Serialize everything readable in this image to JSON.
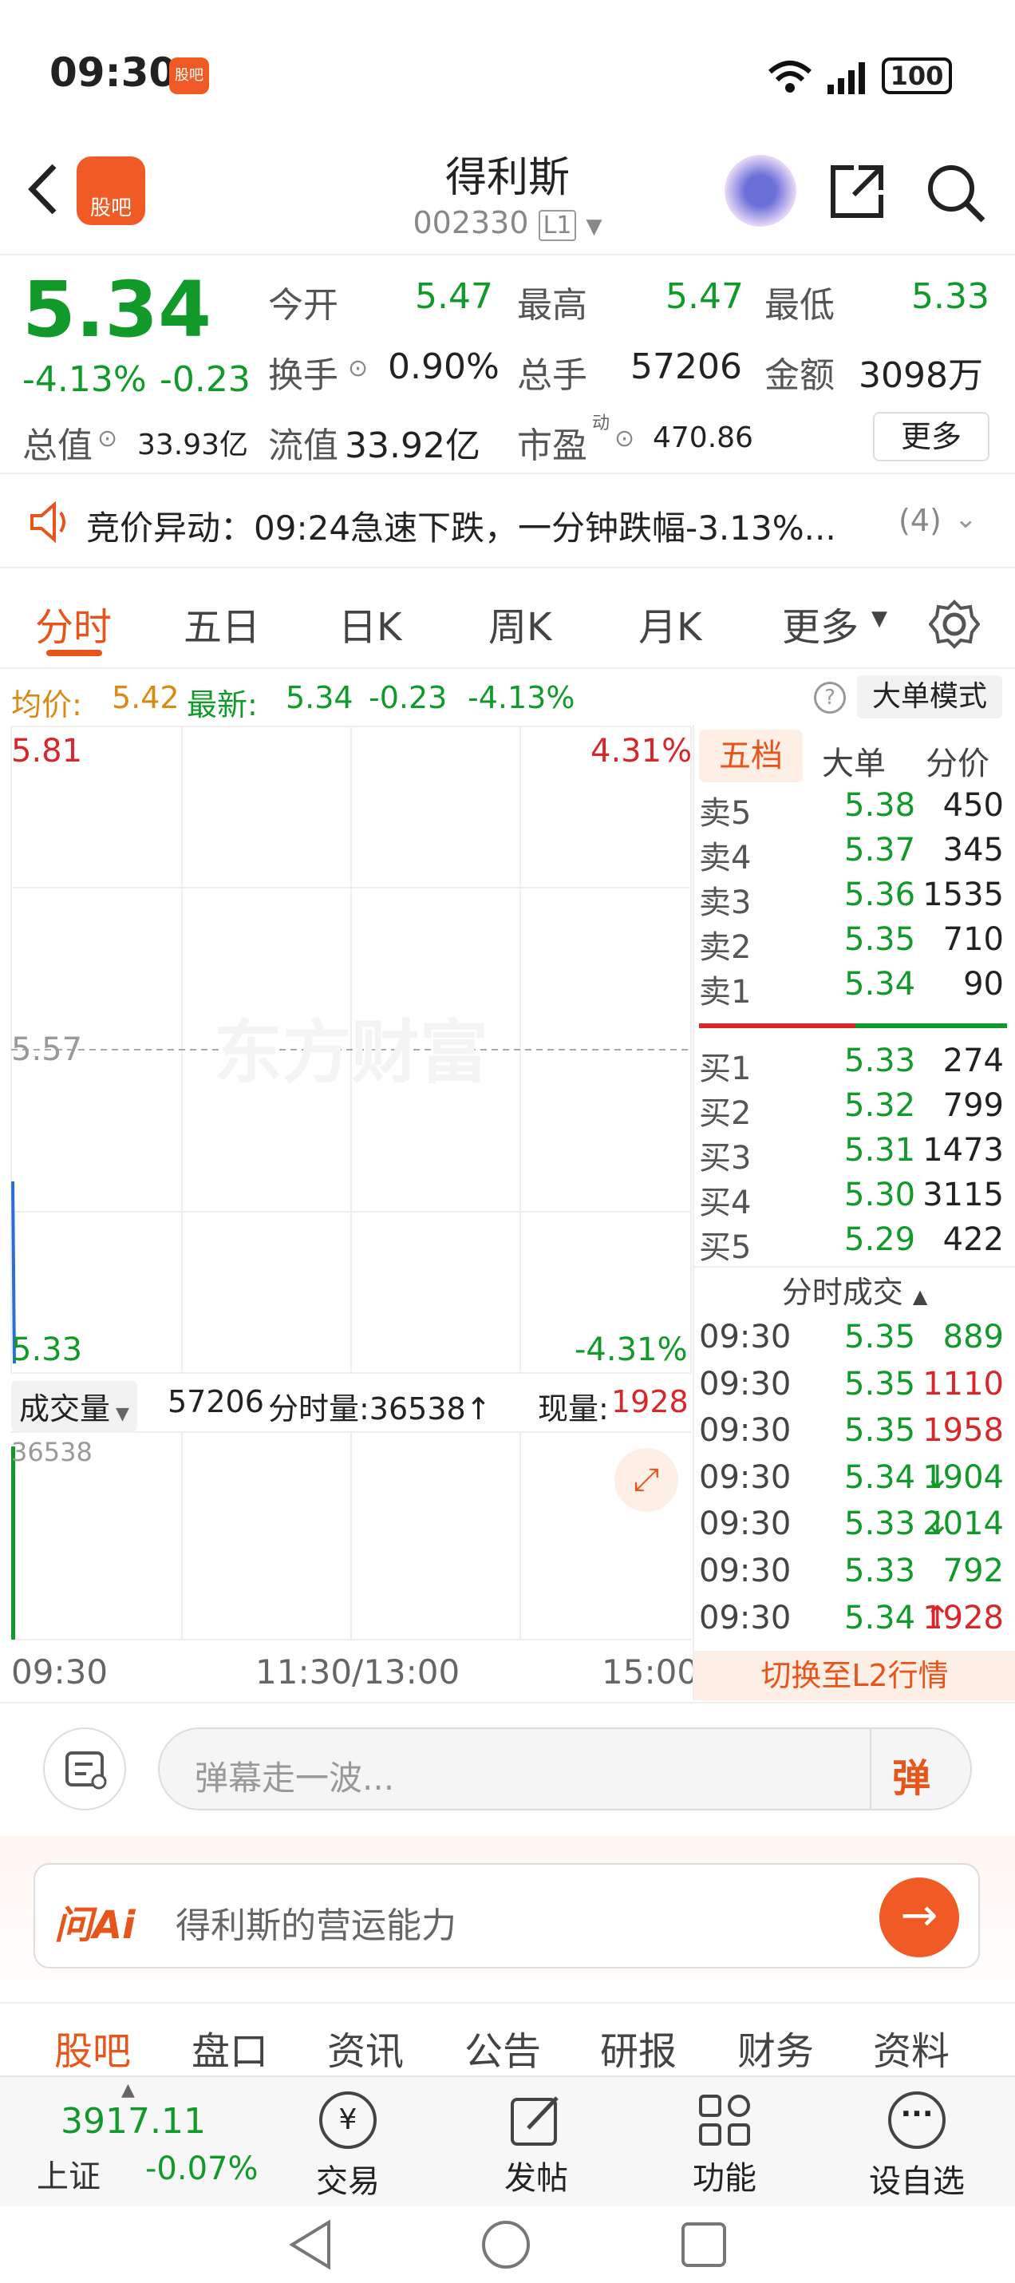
{
  "status": {
    "time": "09:30",
    "app_badge": "股吧",
    "battery": "100"
  },
  "header": {
    "title": "得利斯",
    "code": "002330",
    "level": "L1",
    "logo": "股吧"
  },
  "quote": {
    "price": "5.34",
    "change_pct": "-4.13%",
    "change": "-0.23",
    "open_label": "今开",
    "open": "5.47",
    "high_label": "最高",
    "high": "5.47",
    "low_label": "最低",
    "low": "5.33",
    "turnover_label": "换手",
    "turnover": "0.90%",
    "volume_label": "总手",
    "volume": "57206",
    "amount_label": "金额",
    "amount": "3098万",
    "mktcap_label": "总值",
    "mktcap": "33.93亿",
    "float_label": "流值",
    "float": "33.92亿",
    "pe_label": "市盈",
    "pe_sup": "动",
    "pe": "470.86",
    "more": "更多"
  },
  "alert": {
    "text": "竞价异动：09:24急速下跌，一分钟跌幅-3.13%...",
    "count": "(4)"
  },
  "tabs": [
    "分时",
    "五日",
    "日K",
    "周K",
    "月K",
    "更多",
    "设置"
  ],
  "info_bar": {
    "avg_label": "均价:",
    "avg": "5.42",
    "last_label": "最新:",
    "last": "5.34",
    "chg": "-0.23",
    "pct": "-4.13%",
    "mode": "大单模式"
  },
  "chart": {
    "y_max": "5.81",
    "pct_max": "4.31%",
    "y_mid": "5.57",
    "y_min": "5.33",
    "pct_min": "-4.31%",
    "watermark": "东方财富",
    "vol_label": "成交量",
    "vol_total": "57206",
    "minute_vol": "分时量:36538↑",
    "cur_label": "现量:",
    "cur": "1928",
    "vol_peak": "36538",
    "x_labels": [
      "09:30",
      "11:30/13:00",
      "15:00"
    ]
  },
  "orderbook": {
    "tabs": [
      "五档",
      "大单",
      "分价"
    ],
    "asks": [
      {
        "label": "卖5",
        "price": "5.38",
        "vol": "450"
      },
      {
        "label": "卖4",
        "price": "5.37",
        "vol": "345"
      },
      {
        "label": "卖3",
        "price": "5.36",
        "vol": "1535"
      },
      {
        "label": "卖2",
        "price": "5.35",
        "vol": "710"
      },
      {
        "label": "卖1",
        "price": "5.34",
        "vol": "90"
      }
    ],
    "bids": [
      {
        "label": "买1",
        "price": "5.33",
        "vol": "274"
      },
      {
        "label": "买2",
        "price": "5.32",
        "vol": "799"
      },
      {
        "label": "买3",
        "price": "5.31",
        "vol": "1473"
      },
      {
        "label": "买4",
        "price": "5.30",
        "vol": "3115"
      },
      {
        "label": "买5",
        "price": "5.29",
        "vol": "422"
      }
    ],
    "trades_title": "分时成交",
    "trades": [
      {
        "t": "09:30",
        "p": "5.35",
        "a": "",
        "v": "889",
        "c": "dn"
      },
      {
        "t": "09:30",
        "p": "5.35",
        "a": "",
        "v": "1110",
        "c": "up"
      },
      {
        "t": "09:30",
        "p": "5.35",
        "a": "",
        "v": "1958",
        "c": "up"
      },
      {
        "t": "09:30",
        "p": "5.34",
        "a": "↓",
        "v": "1904",
        "c": "dn"
      },
      {
        "t": "09:30",
        "p": "5.33",
        "a": "↓",
        "v": "2014",
        "c": "dn"
      },
      {
        "t": "09:30",
        "p": "5.33",
        "a": "",
        "v": "792",
        "c": "dn"
      },
      {
        "t": "09:30",
        "p": "5.34",
        "a": "↑",
        "v": "1928",
        "c": "up"
      }
    ],
    "switch": "切换至L2行情"
  },
  "danmu": {
    "placeholder": "弹幕走一波...",
    "btn": "弹"
  },
  "ai": {
    "logo": "问Ai",
    "text": "得利斯的营运能力"
  },
  "subtabs": [
    "股吧",
    "盘口",
    "资讯",
    "公告",
    "研报",
    "财务",
    "资料"
  ],
  "bottom": {
    "index": "3917.11",
    "index_name": "上证",
    "index_pct": "-0.07%",
    "items": [
      "交易",
      "发帖",
      "功能",
      "设自选"
    ]
  },
  "colors": {
    "up": "#d9262a",
    "down": "#119a2a",
    "accent": "#e8551a",
    "avg": "#d98a14"
  }
}
